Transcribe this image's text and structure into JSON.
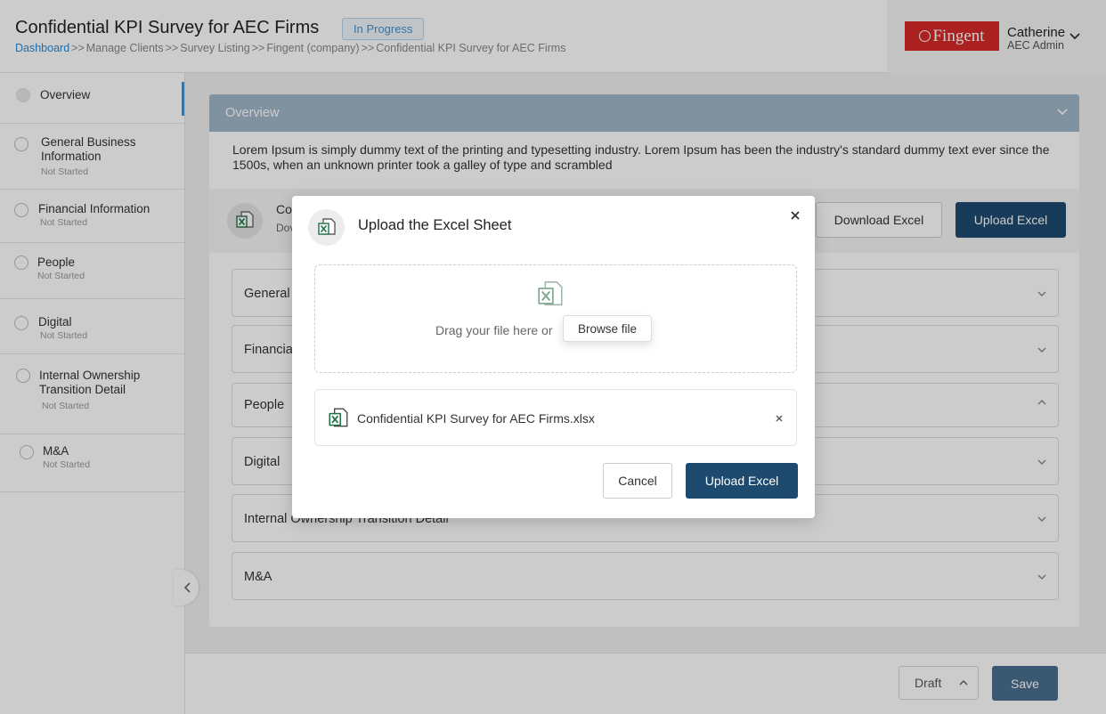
{
  "header": {
    "title": "Confidential KPI Survey for AEC Firms",
    "status": "In Progress",
    "breadcrumb": [
      "Dashboard",
      "Manage Clients",
      "Survey Listing",
      "Fingent (company)",
      "Confidential KPI Survey for AEC Firms"
    ],
    "breadcrumb_separator": ">>"
  },
  "user": {
    "logo_text": "Fingent",
    "name": "Catherine",
    "role": "AEC Admin"
  },
  "sidebar": {
    "items": [
      {
        "label": "Overview",
        "status": ""
      },
      {
        "label": "General Business Information",
        "status": "Not Started"
      },
      {
        "label": "Financial Information",
        "status": "Not Started"
      },
      {
        "label": "People",
        "status": "Not Started"
      },
      {
        "label": "Digital",
        "status": "Not Started"
      },
      {
        "label": "Internal Ownership Transition Detail",
        "status": "Not Started"
      },
      {
        "label": "M&A",
        "status": "Not Started"
      }
    ]
  },
  "main": {
    "panel_title": "Overview",
    "description": "Lorem Ipsum is simply dummy text of the printing and typesetting industry. Lorem Ipsum has been the industry's standard dummy text ever since the 1500s, when an unknown printer took a galley of type and scrambled",
    "excel_bar": {
      "title": "Co",
      "subtitle": "Dov",
      "download_label": "Download Excel",
      "upload_label": "Upload Excel"
    },
    "sections": [
      "General",
      "Financial",
      "People",
      "Digital",
      "Internal Ownership Transition Detail",
      "M&A"
    ]
  },
  "footer": {
    "draft_label": "Draft",
    "save_label": "Save"
  },
  "modal": {
    "title": "Upload the Excel Sheet",
    "drop_text": "Drag your file here or",
    "browse_label": "Browse file",
    "file_name": "Confidential KPI Survey for AEC Firms.xlsx",
    "cancel_label": "Cancel",
    "upload_label": "Upload Excel"
  },
  "colors": {
    "primary": "#1d4a6e",
    "accent": "#2a8ad3",
    "logo_red": "#d62a27",
    "excel_green": "#1e7145"
  },
  "icons": {
    "excel": "excel-file-icon",
    "close": "close-icon",
    "chevron_down": "chevron-down-icon",
    "chevron_up": "chevron-up-icon",
    "chevron_left": "chevron-left-icon"
  }
}
